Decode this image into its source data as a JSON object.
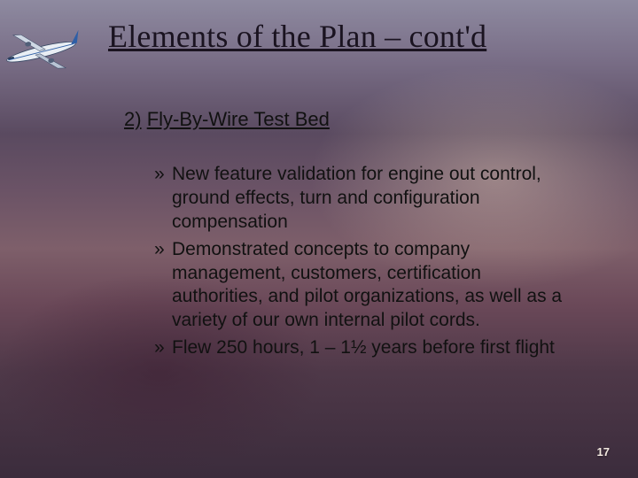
{
  "title": "Elements of the Plan – cont'd",
  "section": {
    "number": "2)",
    "label": "Fly-By-Wire Test Bed"
  },
  "bullets": [
    "New feature validation for engine out control, ground effects, turn and configuration compensation",
    "Demonstrated concepts to company management, customers, certification authorities, and pilot organizations, as well as a variety of our own internal pilot cords.",
    "Flew 250 hours, 1 – 1½ years before first flight"
  ],
  "page_number": "17"
}
